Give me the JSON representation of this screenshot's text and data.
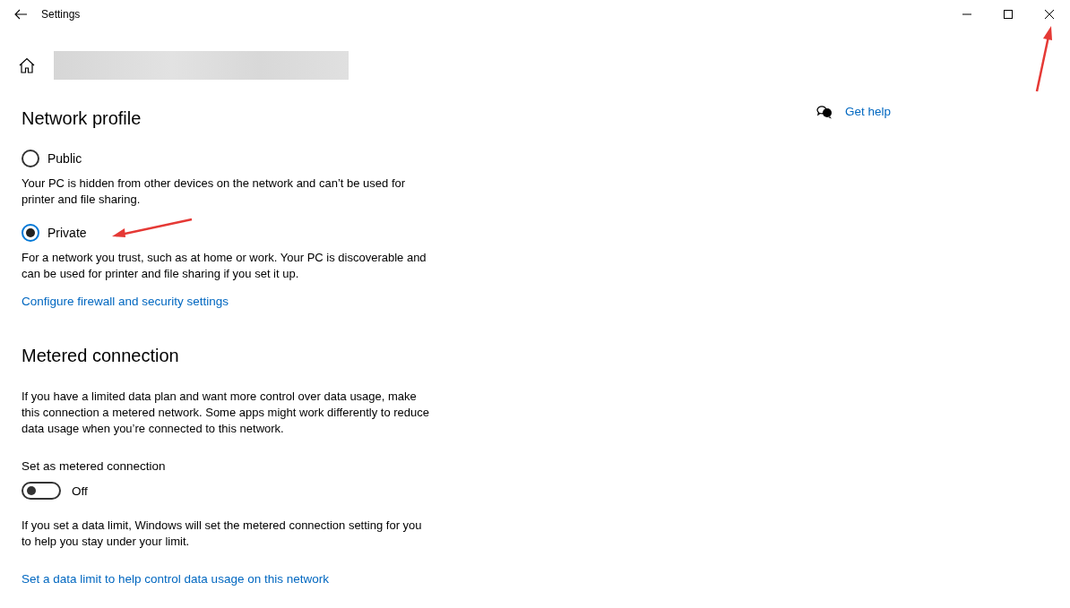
{
  "window": {
    "title": "Settings"
  },
  "get_help": "Get help",
  "network_profile": {
    "heading": "Network profile",
    "options": [
      {
        "label": "Public",
        "selected": false,
        "description": "Your PC is hidden from other devices on the network and can’t be used for printer and file sharing."
      },
      {
        "label": "Private",
        "selected": true,
        "description": "For a network you trust, such as at home or work. Your PC is discoverable and can be used for printer and file sharing if you set it up."
      }
    ],
    "link": "Configure firewall and security settings"
  },
  "metered_connection": {
    "heading": "Metered connection",
    "description": "If you have a limited data plan and want more control over data usage, make this connection a metered network. Some apps might work differently to reduce data usage when you’re connected to this network.",
    "toggle_label": "Set as metered connection",
    "on": false,
    "state_text": "Off",
    "note": "If you set a data limit, Windows will set the metered connection setting for you to help you stay under your limit.",
    "link": "Set a data limit to help control data usage on this network"
  }
}
